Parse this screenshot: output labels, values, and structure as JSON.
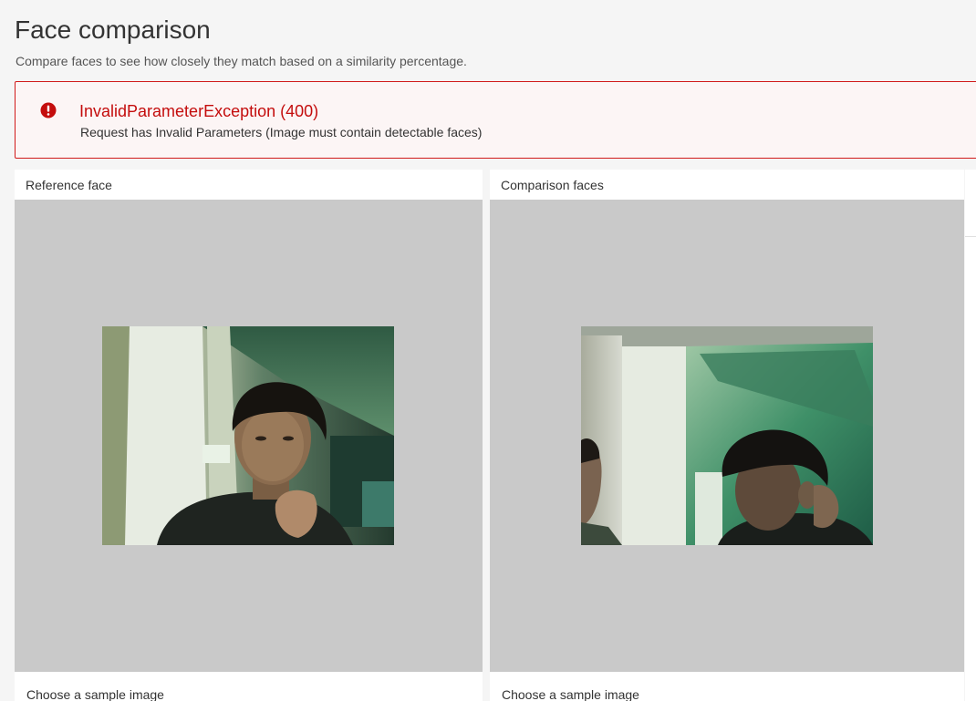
{
  "page": {
    "title": "Face comparison",
    "subtitle": "Compare faces to see how closely they match based on a similarity percentage."
  },
  "error": {
    "icon": "error-circle-icon",
    "title": "InvalidParameterException (400)",
    "message": "Request has Invalid Parameters (Image must contain detectable faces)",
    "color": "#c40d0d"
  },
  "reference_panel": {
    "label": "Reference face",
    "image_alt": "reference-face-photo",
    "sample_label": "Choose a sample image"
  },
  "comparison_panel": {
    "label": "Comparison faces",
    "image_alt": "comparison-faces-photo",
    "sample_label": "Choose a sample image"
  },
  "colors": {
    "image_background": "#c9c9c9",
    "error_border": "#d11a1a",
    "error_background": "#fcf5f5"
  }
}
